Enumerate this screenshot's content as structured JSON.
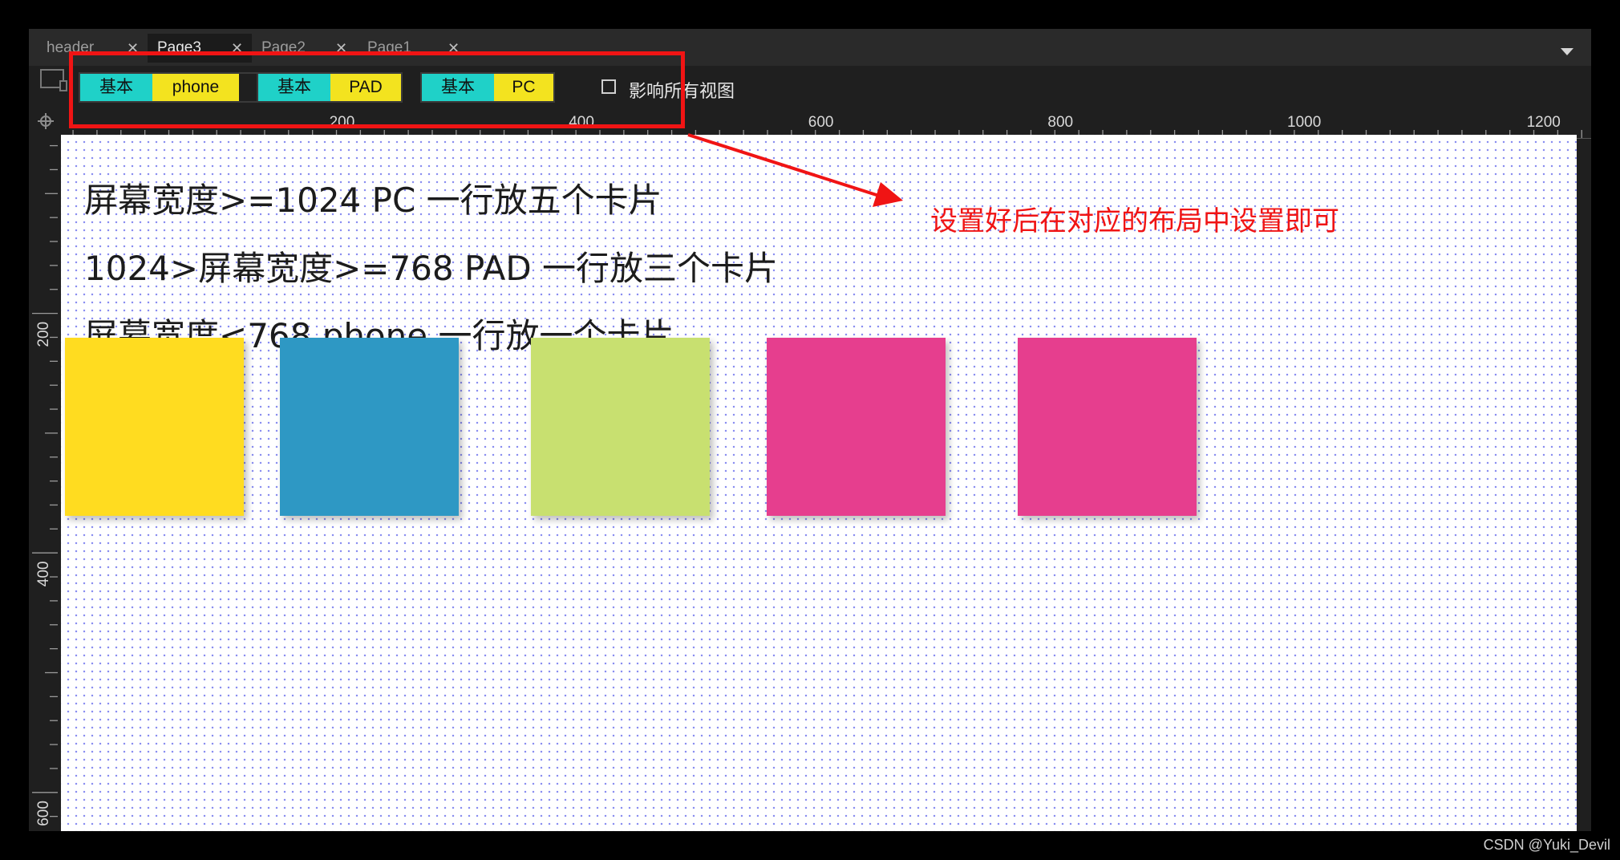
{
  "tabs": [
    {
      "label": "header",
      "active": false
    },
    {
      "label": "Page3",
      "active": true
    },
    {
      "label": "Page2",
      "active": false
    },
    {
      "label": "Page1",
      "active": false
    }
  ],
  "toolbar": {
    "groups": [
      {
        "base": "基本",
        "variant": "phone"
      },
      {
        "base": "基本",
        "variant": "PAD"
      },
      {
        "base": "基本",
        "variant": "PC"
      }
    ],
    "affect_all_views_label": "影响所有视图",
    "affect_all_views_checked": false
  },
  "ruler": {
    "horizontal_labels": [
      "200",
      "400",
      "600",
      "800",
      "1000",
      "1200"
    ],
    "vertical_labels": [
      "200",
      "400",
      "600"
    ]
  },
  "canvas": {
    "lines": [
      "屏幕宽度>=1024 PC 一行放五个卡片",
      "1024>屏幕宽度>=768 PAD 一行放三个卡片",
      "屏幕宽度<768 phone 一行放一个卡片"
    ],
    "cards": [
      {
        "color": "#ffdc20"
      },
      {
        "color": "#2e98c4"
      },
      {
        "color": "#c8e070"
      },
      {
        "color": "#e63e8e"
      },
      {
        "color": "#e63e8e"
      }
    ]
  },
  "annotation": {
    "text": "设置好后在对应的布局中设置即可",
    "color": "#f01414"
  },
  "watermark": "CSDN @Yuki_Devil",
  "colors": {
    "base_segment": "#1fd1c8",
    "variant_segment": "#f3e31f",
    "grid_dot": "#8a8ef0"
  }
}
